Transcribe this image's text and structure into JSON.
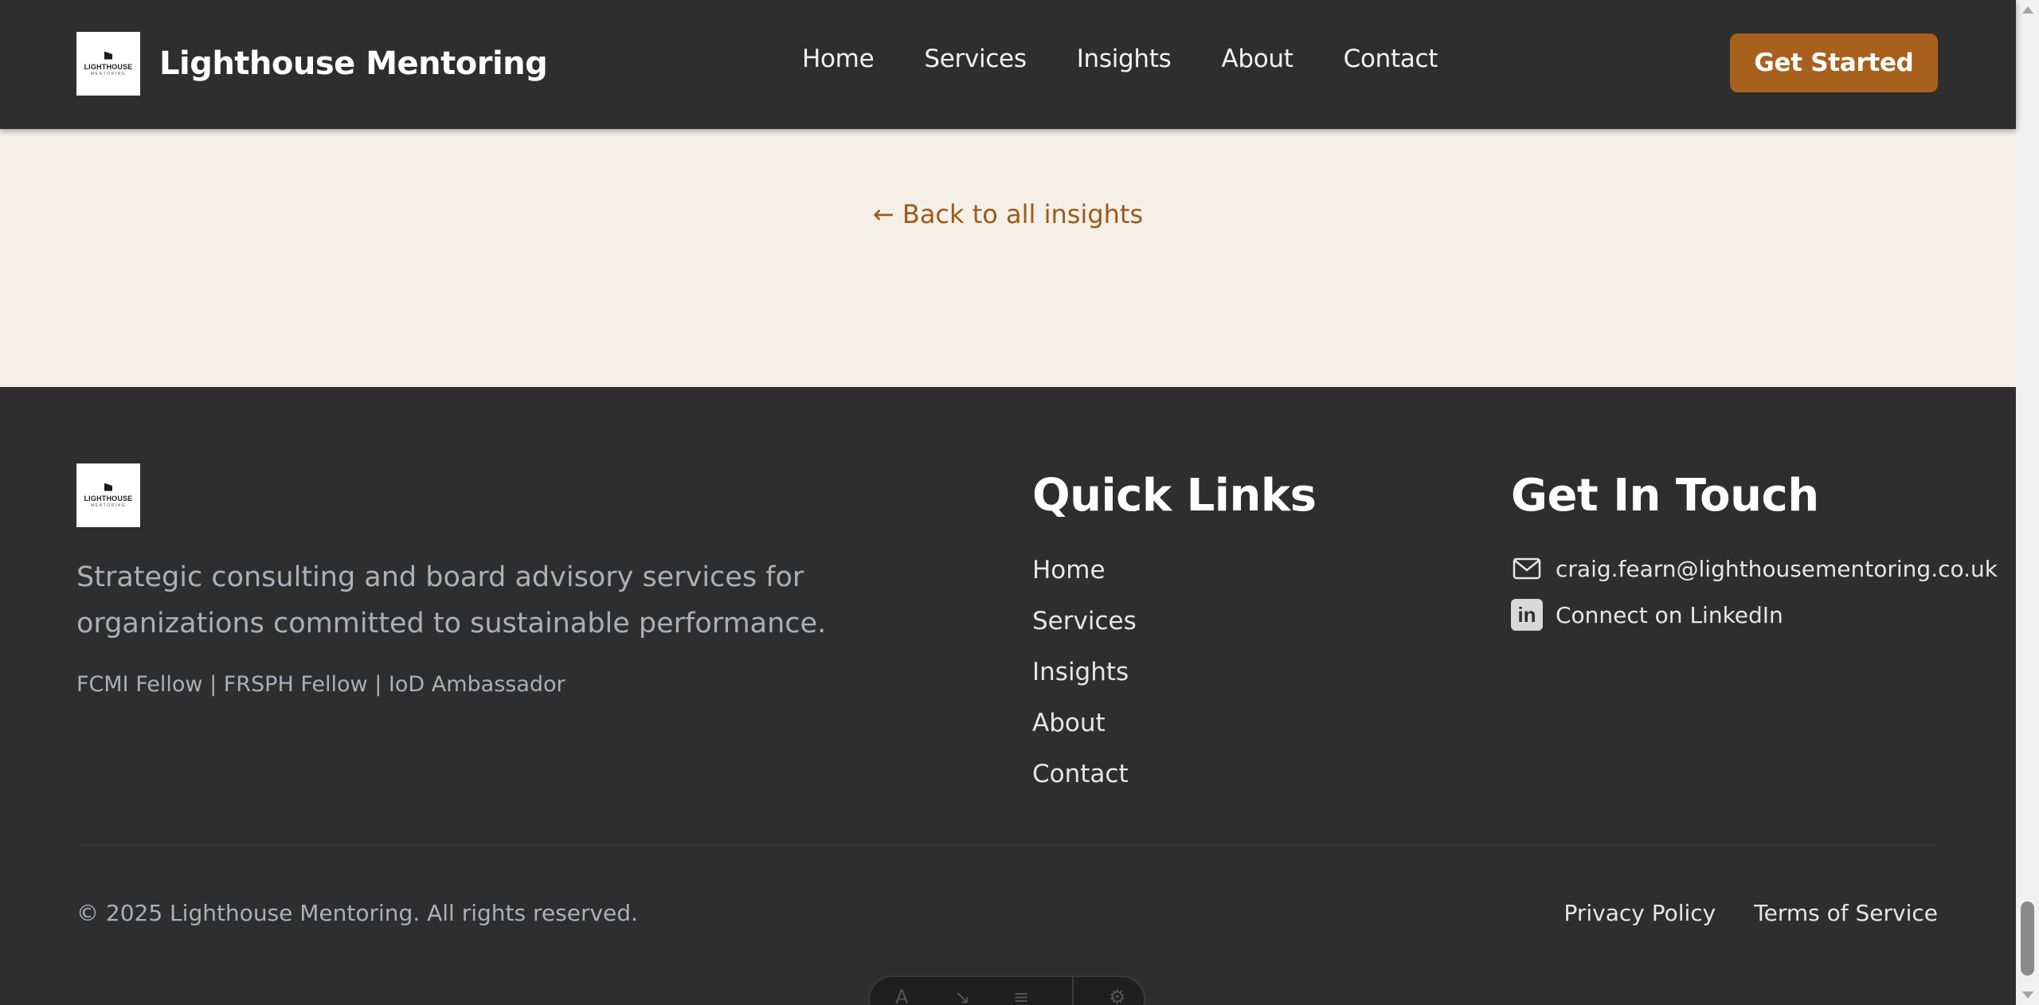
{
  "header": {
    "logo_text": "LIGHTHOUSE",
    "logo_sub": "MENTORING",
    "brand_name": "Lighthouse Mentoring",
    "nav": [
      "Home",
      "Services",
      "Insights",
      "About",
      "Contact"
    ],
    "cta_label": "Get Started"
  },
  "main": {
    "back_link": "← Back to all insights"
  },
  "footer": {
    "logo_text": "LIGHTHOUSE",
    "logo_sub": "MENTORING",
    "description": "Strategic consulting and board advisory services for organizations committed to sustainable performance.",
    "credentials": "FCMI Fellow | FRSPH Fellow | IoD Ambassador",
    "quick_links_title": "Quick Links",
    "quick_links": [
      "Home",
      "Services",
      "Insights",
      "About",
      "Contact"
    ],
    "get_in_touch_title": "Get In Touch",
    "email": "craig.fearn@lighthousementoring.co.uk",
    "linkedin_label": "Connect on LinkedIn",
    "copyright": "© 2025 Lighthouse Mentoring. All rights reserved.",
    "privacy_label": "Privacy Policy",
    "terms_label": "Terms of Service"
  },
  "icons": {
    "mail": "mail-icon",
    "linkedin": "linkedin-icon"
  },
  "colors": {
    "header_bg": "#2e2e2e",
    "accent": "#a8601d",
    "cream": "#f4f0e8",
    "link": "#9c5a1a"
  }
}
